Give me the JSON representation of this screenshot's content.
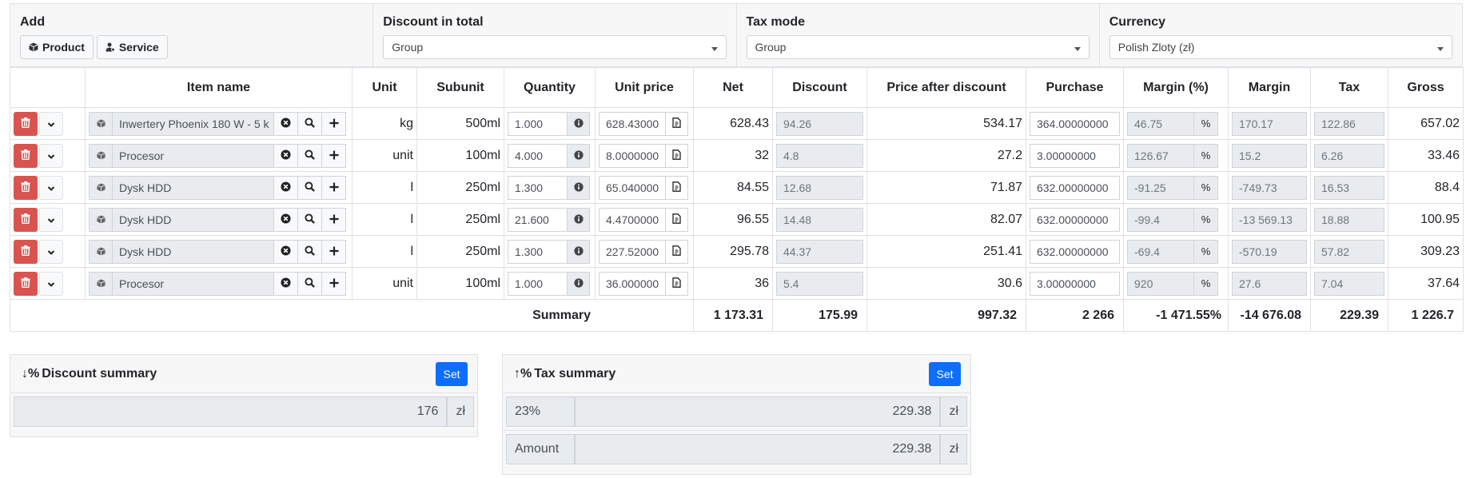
{
  "header": {
    "add": {
      "title": "Add",
      "product_label": "Product",
      "service_label": "Service"
    },
    "discount": {
      "title": "Discount in total",
      "value": "Group"
    },
    "tax_mode": {
      "title": "Tax mode",
      "value": "Group"
    },
    "currency": {
      "title": "Currency",
      "value": "Polish Zloty (zł)"
    }
  },
  "table": {
    "columns": [
      "Item name",
      "Unit",
      "Subunit",
      "Quantity",
      "Unit price",
      "Net",
      "Discount",
      "Price after discount",
      "Purchase",
      "Margin (%)",
      "Margin",
      "Tax",
      "Gross"
    ],
    "rows": [
      {
        "name": "Inwertery Phoenix 180 W - 5 k",
        "unit": "kg",
        "subunit": "500ml",
        "quantity": "1.000",
        "unit_price": "628.43000",
        "net": "628.43",
        "discount": "94.26",
        "price_after": "534.17",
        "purchase": "364.00000000",
        "margin_pct": "46.75",
        "pct": "%",
        "margin": "170.17",
        "tax": "122.86",
        "gross": "657.02"
      },
      {
        "name": "Procesor",
        "unit": "unit",
        "subunit": "100ml",
        "quantity": "4.000",
        "unit_price": "8.0000000",
        "net": "32",
        "discount": "4.8",
        "price_after": "27.2",
        "purchase": "3.00000000",
        "margin_pct": "126.67",
        "pct": "%",
        "margin": "15.2",
        "tax": "6.26",
        "gross": "33.46"
      },
      {
        "name": "Dysk HDD",
        "unit": "l",
        "subunit": "250ml",
        "quantity": "1.300",
        "unit_price": "65.040000",
        "net": "84.55",
        "discount": "12.68",
        "price_after": "71.87",
        "purchase": "632.00000000",
        "margin_pct": "-91.25",
        "pct": "%",
        "margin": "-749.73",
        "tax": "16.53",
        "gross": "88.4"
      },
      {
        "name": "Dysk HDD",
        "unit": "l",
        "subunit": "250ml",
        "quantity": "21.600",
        "unit_price": "4.4700000",
        "net": "96.55",
        "discount": "14.48",
        "price_after": "82.07",
        "purchase": "632.00000000",
        "margin_pct": "-99.4",
        "pct": "%",
        "margin": "-13 569.13",
        "tax": "18.88",
        "gross": "100.95"
      },
      {
        "name": "Dysk HDD",
        "unit": "l",
        "subunit": "250ml",
        "quantity": "1.300",
        "unit_price": "227.52000",
        "net": "295.78",
        "discount": "44.37",
        "price_after": "251.41",
        "purchase": "632.00000000",
        "margin_pct": "-69.4",
        "pct": "%",
        "margin": "-570.19",
        "tax": "57.82",
        "gross": "309.23"
      },
      {
        "name": "Procesor",
        "unit": "unit",
        "subunit": "100ml",
        "quantity": "1.000",
        "unit_price": "36.000000",
        "net": "36",
        "discount": "5.4",
        "price_after": "30.6",
        "purchase": "3.00000000",
        "margin_pct": "920",
        "pct": "%",
        "margin": "27.6",
        "tax": "7.04",
        "gross": "37.64"
      }
    ],
    "summary": {
      "label": "Summary",
      "net": "1 173.31",
      "discount": "175.99",
      "price_after": "997.32",
      "purchase": "2 266",
      "margin_pct": "-1 471.55%",
      "margin": "-14 676.08",
      "tax": "229.39",
      "gross": "1 226.7"
    }
  },
  "discount_summary": {
    "icon": "↓%",
    "title": "Discount summary",
    "set_label": "Set",
    "value": "176",
    "currency": "zł"
  },
  "tax_summary": {
    "icon": "↑%",
    "title": "Tax summary",
    "set_label": "Set",
    "lines": [
      {
        "label": "23%",
        "value": "229.38",
        "currency": "zł"
      },
      {
        "label": "Amount",
        "value": "229.38",
        "currency": "zł"
      }
    ]
  },
  "colors": {
    "danger": "#d9534f",
    "primary": "#0d6efd",
    "readonly_bg": "#e9ecef"
  }
}
